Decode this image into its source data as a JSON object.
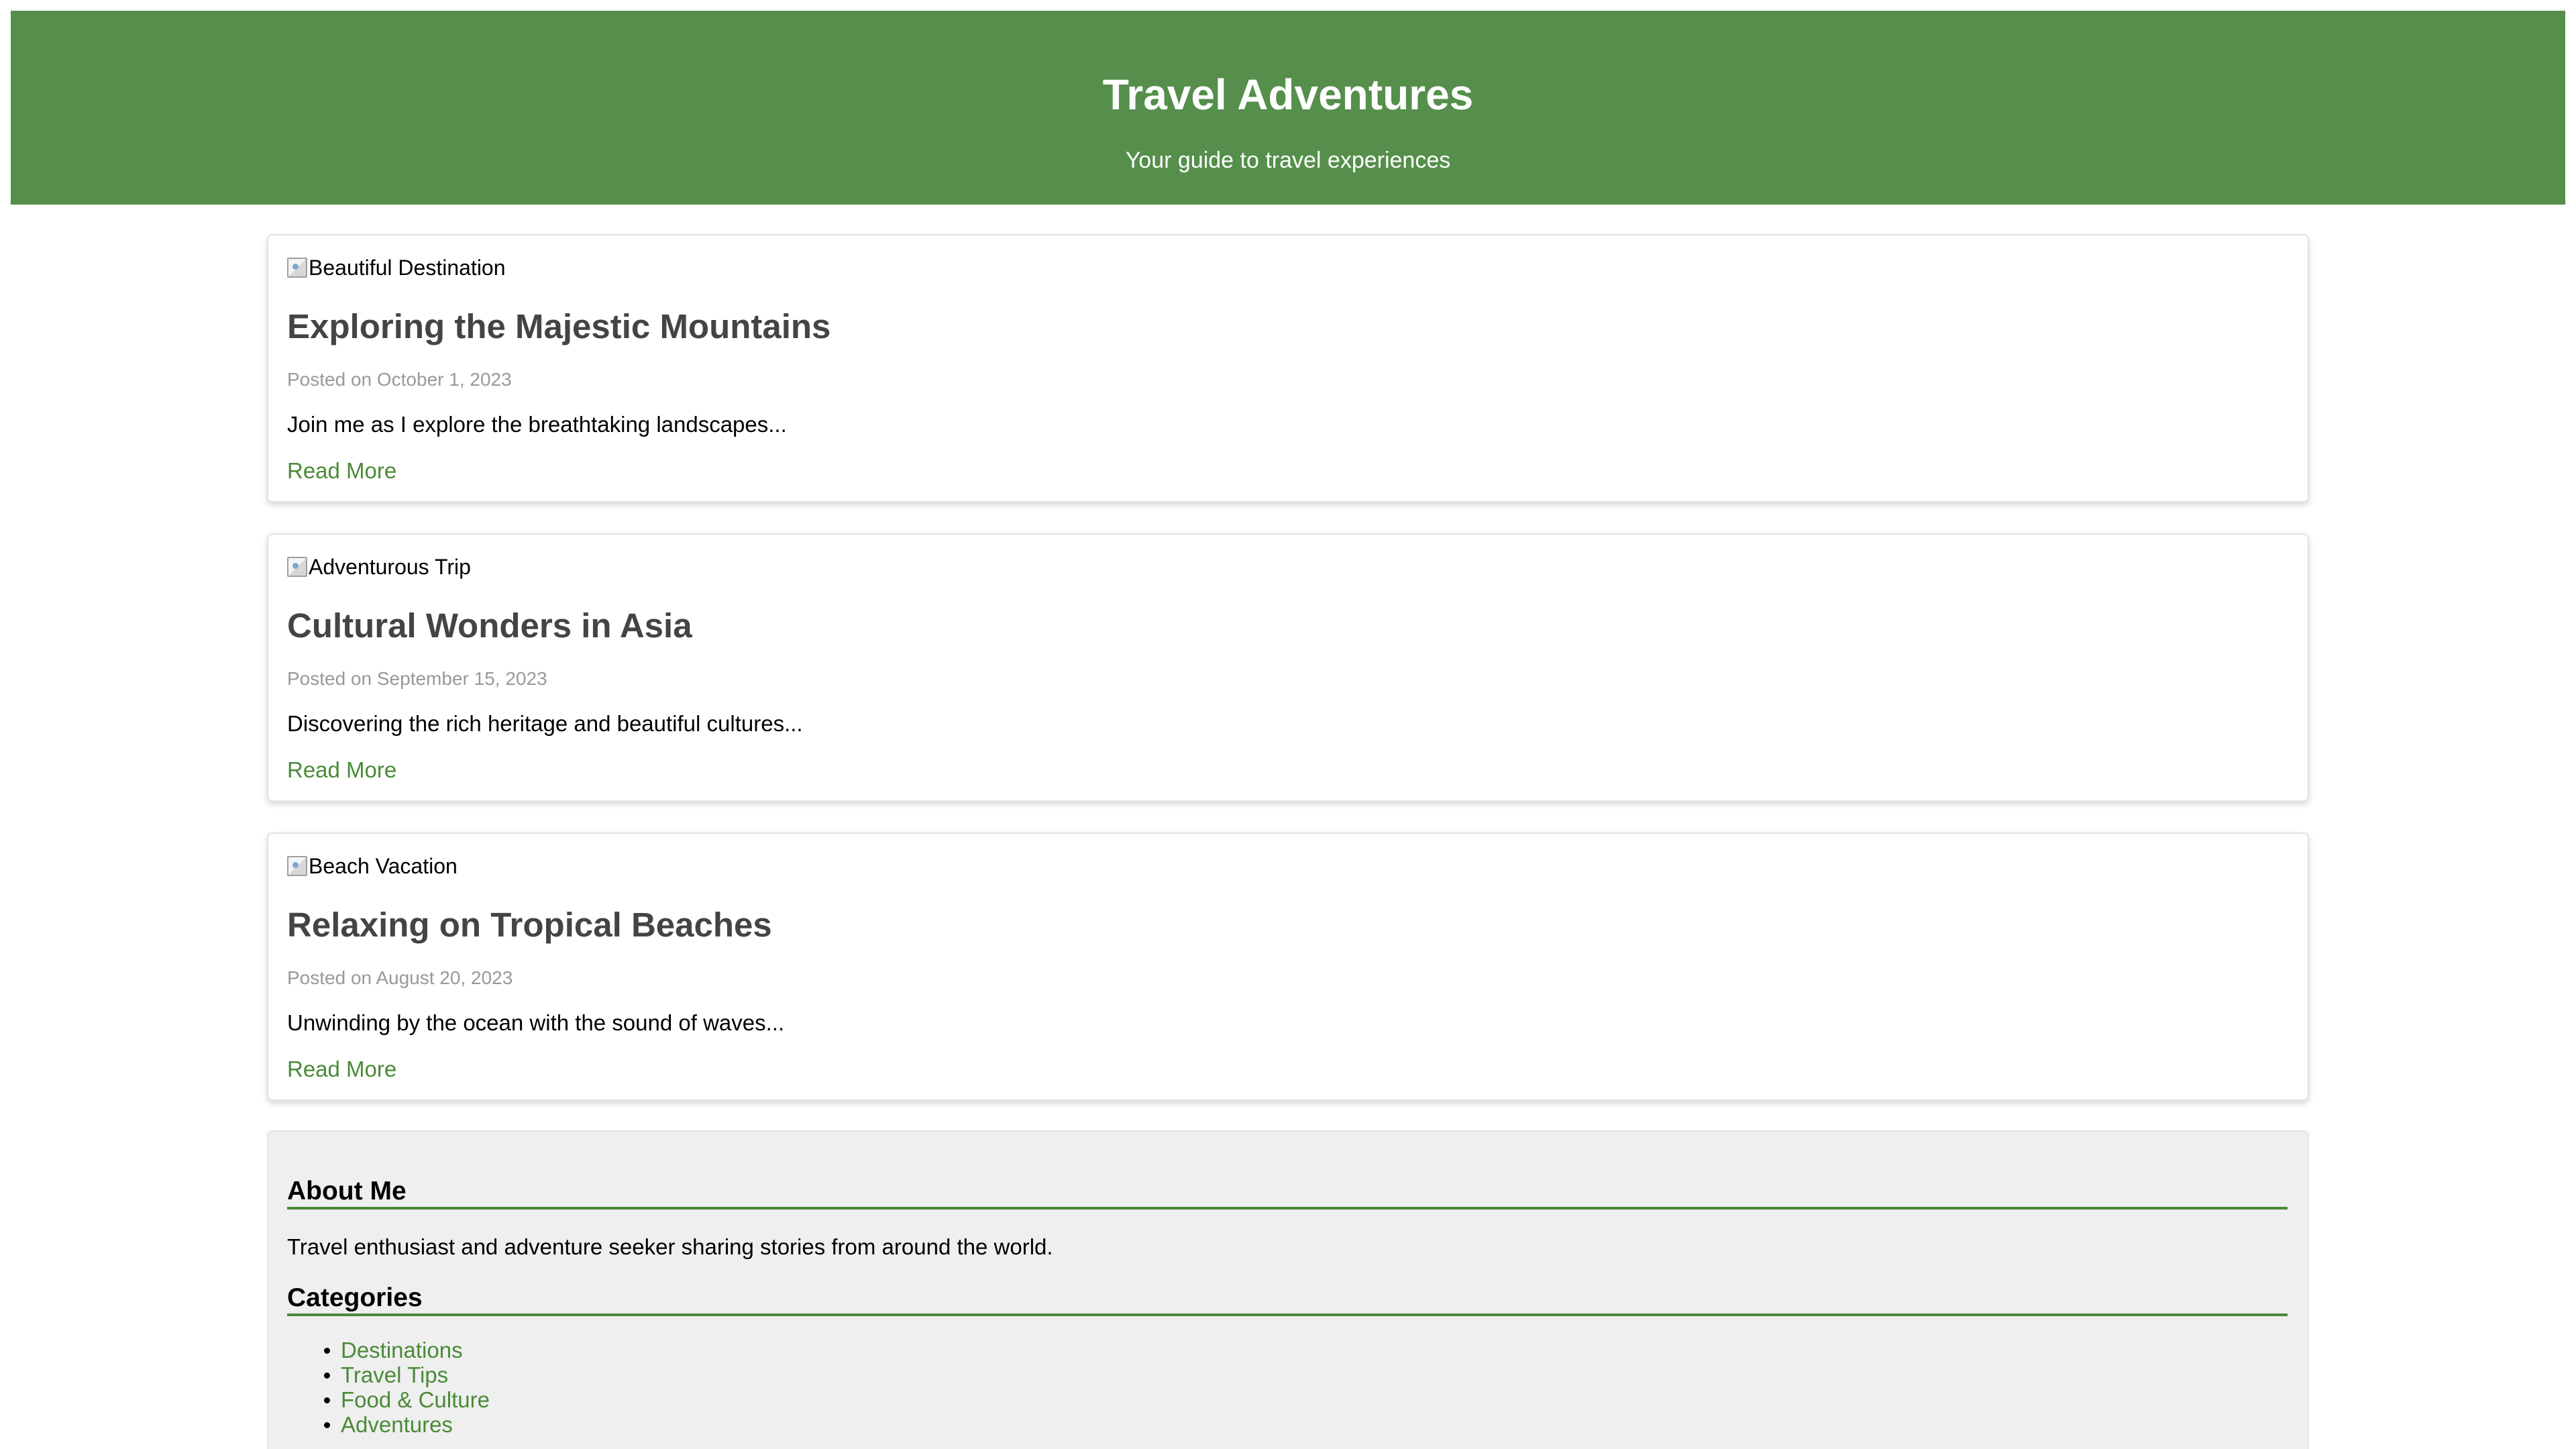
{
  "header": {
    "title": "Travel Adventures",
    "tagline": "Your guide to travel experiences"
  },
  "posts": [
    {
      "image_alt": "Beautiful Destination",
      "title": "Exploring the Majestic Mountains",
      "date": "Posted on October 1, 2023",
      "excerpt": "Join me as I explore the breathtaking landscapes...",
      "read_more": "Read More"
    },
    {
      "image_alt": "Adventurous Trip",
      "title": "Cultural Wonders in Asia",
      "date": "Posted on September 15, 2023",
      "excerpt": "Discovering the rich heritage and beautiful cultures...",
      "read_more": "Read More"
    },
    {
      "image_alt": "Beach Vacation",
      "title": "Relaxing on Tropical Beaches",
      "date": "Posted on August 20, 2023",
      "excerpt": "Unwinding by the ocean with the sound of waves...",
      "read_more": "Read More"
    }
  ],
  "sidebar": {
    "about": {
      "title": "About Me",
      "text": "Travel enthusiast and adventure seeker sharing stories from around the world."
    },
    "categories": {
      "title": "Categories",
      "items": [
        "Destinations",
        "Travel Tips",
        "Food & Culture",
        "Adventures"
      ]
    }
  },
  "colors": {
    "header_background": "#558f4b",
    "accent": "#4a8a37",
    "post_title": "#444444",
    "muted_text": "#999999",
    "sidebar_background": "#efefef"
  },
  "icons": {
    "broken_image": "broken-image-icon",
    "category_bullet": "bullet-icon"
  }
}
